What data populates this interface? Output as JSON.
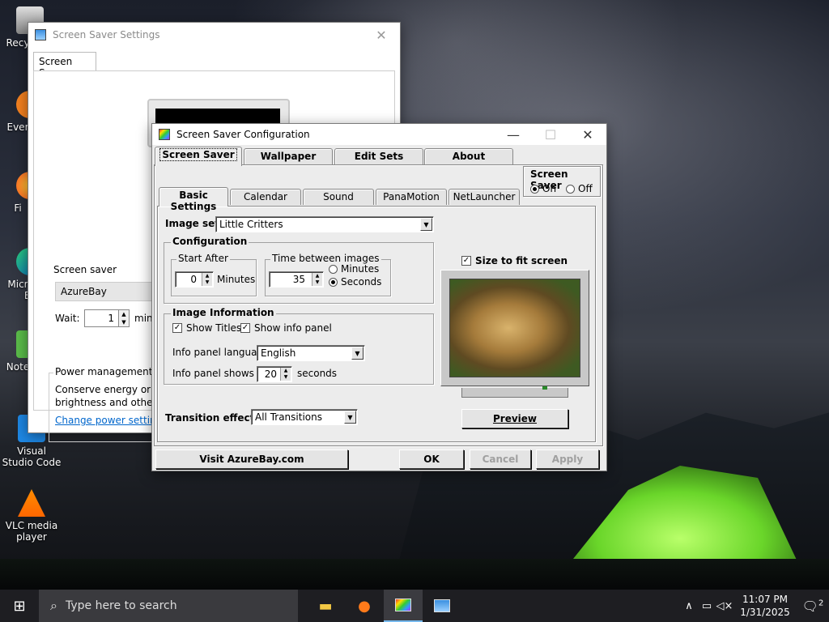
{
  "desktop": {
    "icons": [
      {
        "label": "Recy",
        "icon": "recycle-bin-icon"
      },
      {
        "label": "Ever",
        "icon": "evernote-icon"
      },
      {
        "label": "Fi",
        "icon": "firefox-icon"
      },
      {
        "label": "Micr\nEc",
        "icon": "edge-icon"
      },
      {
        "label": "Note",
        "icon": "notepad-icon"
      },
      {
        "label": "Visual Studio Code",
        "icon": "vscode-icon"
      },
      {
        "label": "VLC media player",
        "icon": "vlc-icon"
      }
    ]
  },
  "ss_settings": {
    "title": "Screen Saver Settings",
    "tab": "Screen Saver",
    "screen_saver_label": "Screen saver",
    "screen_saver_value": "AzureBay",
    "wait_label": "Wait:",
    "wait_value": "1",
    "wait_unit": "min",
    "power_title": "Power management",
    "power_text_1": "Conserve energy or ma",
    "power_text_2": "brightness and other p",
    "power_link": "Change power settings"
  },
  "cfg": {
    "title": "Screen Saver Configuration",
    "main_tabs": [
      "Screen Saver",
      "Wallpaper",
      "Edit Sets",
      "About"
    ],
    "sub_tabs": [
      "Basic Settings",
      "Calendar",
      "Sound",
      "PanaMotion",
      "NetLauncher"
    ],
    "toggle_group": {
      "title": "Screen Saver",
      "on": "On",
      "off": "Off",
      "selected": "On"
    },
    "image_set_label": "Image set:",
    "image_set_value": "Little Critters",
    "configuration": {
      "title": "Configuration",
      "start_after_title": "Start After",
      "start_after_value": "0",
      "start_after_unit": "Minutes",
      "time_between_title": "Time between images",
      "time_between_value": "35",
      "unit_minutes": "Minutes",
      "unit_seconds": "Seconds",
      "unit_selected": "Seconds"
    },
    "image_info": {
      "title": "Image Information",
      "show_titles": "Show Titles",
      "show_titles_checked": true,
      "show_info_panel": "Show info panel",
      "show_info_panel_checked": true,
      "language_label": "Info panel language:",
      "language_value": "English",
      "shows_for_label": "Info panel shows for:",
      "shows_for_value": "20",
      "shows_for_unit": "seconds"
    },
    "transition_label": "Transition effects:",
    "transition_value": "All Transitions",
    "fit_screen_label": "Size to fit screen",
    "fit_screen_checked": true,
    "preview_button": "Preview",
    "visit_button": "Visit AzureBay.com",
    "ok_button": "OK",
    "cancel_button": "Cancel",
    "apply_button": "Apply"
  },
  "taskbar": {
    "search_placeholder": "Type here to search",
    "time": "11:07 PM",
    "date": "1/31/2025",
    "notifications": "2"
  }
}
